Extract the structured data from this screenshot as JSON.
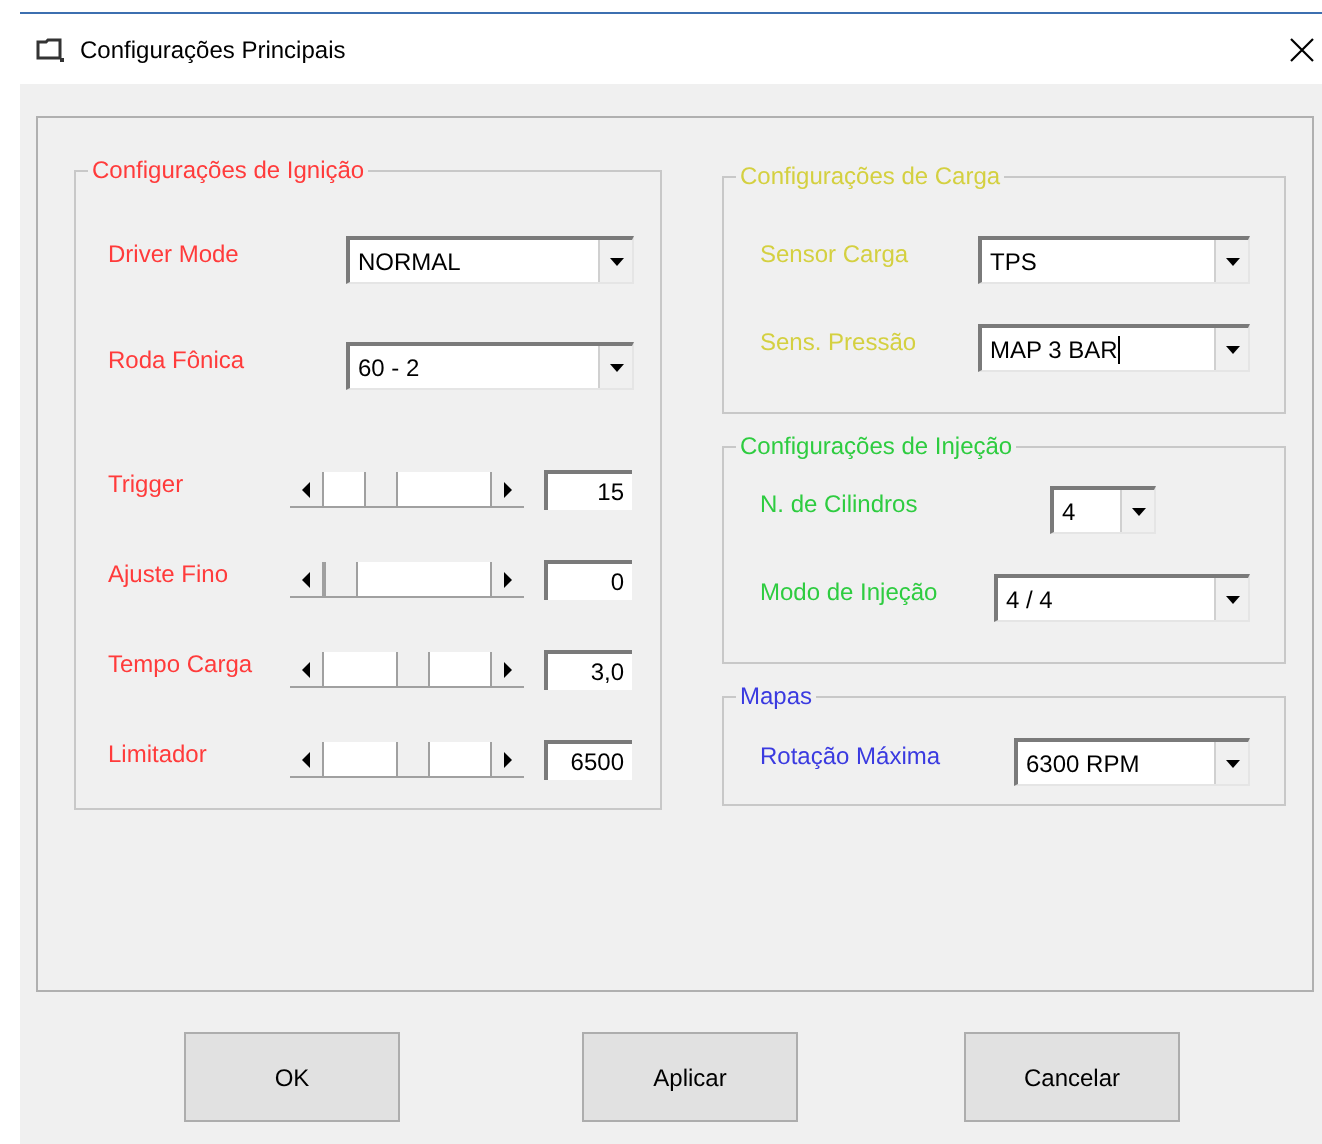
{
  "window": {
    "title": "Configurações Principais"
  },
  "columns": [
    {
      "groups": [
        {
          "title": "Configurações de Ignição",
          "color": "#ff3b3b",
          "fields": [
            {
              "kind": "dropdown",
              "label": "Driver Mode",
              "value": "NORMAL"
            },
            {
              "kind": "dropdown",
              "label": "Roda Fônica",
              "value": "60 - 2"
            },
            {
              "kind": "slider",
              "label": "Trigger",
              "value": "15",
              "level": 0.3
            },
            {
              "kind": "slider",
              "label": "Ajuste Fino",
              "value": "0",
              "level": 0
            },
            {
              "kind": "slider",
              "label": "Tempo Carga",
              "value": "3,0",
              "level": 0.55
            },
            {
              "kind": "slider",
              "label": "Limitador",
              "value": "6500",
              "level": 0.55
            }
          ]
        }
      ]
    },
    {
      "groups": [
        {
          "title": "Configurações de Carga",
          "color": "#d4d040",
          "fields": [
            {
              "kind": "dropdown",
              "label": "Sensor Carga",
              "value": "TPS"
            },
            {
              "kind": "dropdown",
              "label": "Sens. Pressão",
              "value": "MAP 3 BAR",
              "cursor": true
            }
          ]
        },
        {
          "title": "Configurações de Injeção",
          "color": "#2ecc40",
          "fields": [
            {
              "kind": "small-dropdown",
              "label": "N. de Cilindros",
              "value": "4"
            },
            {
              "kind": "dropdown",
              "label": "Modo de Injeção",
              "value": "4 / 4"
            }
          ]
        },
        {
          "title": "Mapas",
          "color": "#3a3ae0",
          "fields": [
            {
              "kind": "dropdown",
              "label": "Rotação Máxima",
              "value": "6300 RPM"
            }
          ]
        }
      ]
    }
  ],
  "buttons": [
    "OK",
    "Aplicar",
    "Cancelar"
  ]
}
